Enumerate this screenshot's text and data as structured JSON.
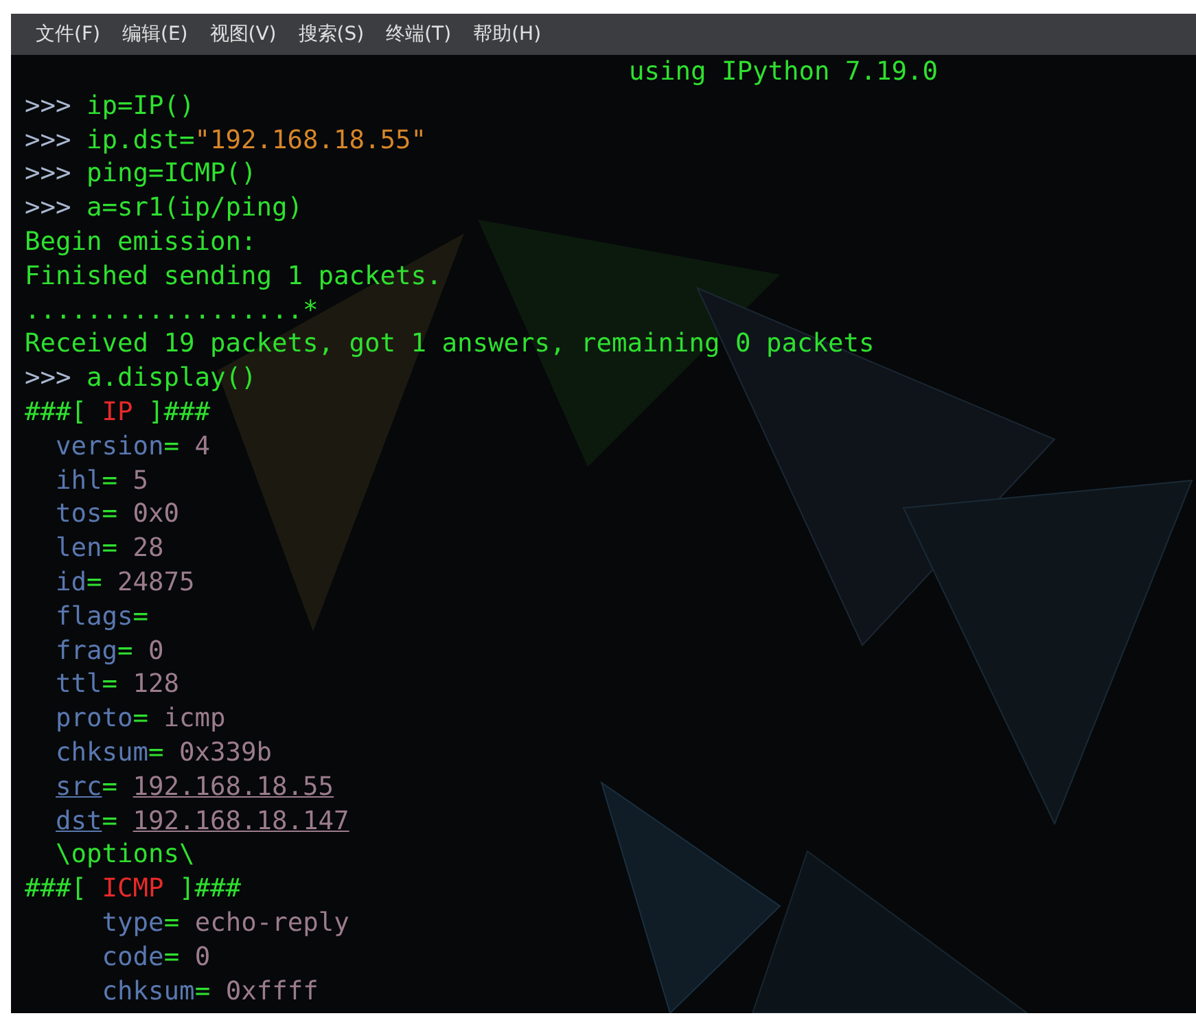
{
  "menu": [
    {
      "label": "文件(F)"
    },
    {
      "label": "编辑(E)"
    },
    {
      "label": "视图(V)"
    },
    {
      "label": "搜索(S)"
    },
    {
      "label": "终端(T)"
    },
    {
      "label": "帮助(H)"
    }
  ],
  "banner": "using IPython 7.19.0",
  "lines": [
    {
      "kind": "input",
      "prompt": ">>>",
      "segments": [
        {
          "kind": "code",
          "text": "ip=IP()"
        }
      ]
    },
    {
      "kind": "input",
      "prompt": ">>>",
      "segments": [
        {
          "kind": "code",
          "text": "ip.dst="
        },
        {
          "kind": "string",
          "text": "\"192.168.18.55\""
        }
      ]
    },
    {
      "kind": "input",
      "prompt": ">>>",
      "segments": [
        {
          "kind": "code",
          "text": "ping=ICMP()"
        }
      ]
    },
    {
      "kind": "input",
      "prompt": ">>>",
      "segments": [
        {
          "kind": "code",
          "text": "a=sr1(ip/ping)"
        }
      ]
    },
    {
      "kind": "output",
      "text": "Begin emission:"
    },
    {
      "kind": "output",
      "text": "Finished sending 1 packets."
    },
    {
      "kind": "progress",
      "text": "..................*"
    },
    {
      "kind": "output",
      "text": "Received 19 packets, got 1 answers, remaining 0 packets"
    },
    {
      "kind": "input",
      "prompt": ">>>",
      "segments": [
        {
          "kind": "code",
          "text": "a.display()"
        }
      ]
    }
  ],
  "layer": {
    "open": "###[",
    "name": "IP",
    "close": "]###",
    "sep": "=",
    "fields": [
      {
        "name": "version",
        "value": "4",
        "underlined": false
      },
      {
        "name": "ihl",
        "value": "5",
        "underlined": false
      },
      {
        "name": "tos",
        "value": "0x0",
        "underlined": false
      },
      {
        "name": "len",
        "value": "28",
        "underlined": false
      },
      {
        "name": "id",
        "value": "24875",
        "underlined": false
      },
      {
        "name": "flags",
        "underlined": false
      },
      {
        "name": "frag",
        "value": "0",
        "underlined": false
      },
      {
        "name": "ttl",
        "value": "128",
        "underlined": false
      },
      {
        "name": "proto",
        "value": "icmp",
        "underlined": false
      },
      {
        "name": "chksum",
        "value": "0x339b",
        "underlined": false
      },
      {
        "name": "src",
        "value": "192.168.18.55",
        "underlined": true
      },
      {
        "name": "dst",
        "value": "192.168.18.147",
        "underlined": true
      }
    ],
    "options": "\\options\\",
    "payload": {
      "open": "###[",
      "name": "ICMP",
      "close": "]###",
      "sep": "=",
      "fields": [
        {
          "name": "type",
          "value": "echo-reply",
          "underlined": false
        },
        {
          "name": "code",
          "value": "0",
          "underlined": false
        },
        {
          "name": "chksum",
          "value": "0xffff",
          "underlined": false
        }
      ]
    }
  }
}
